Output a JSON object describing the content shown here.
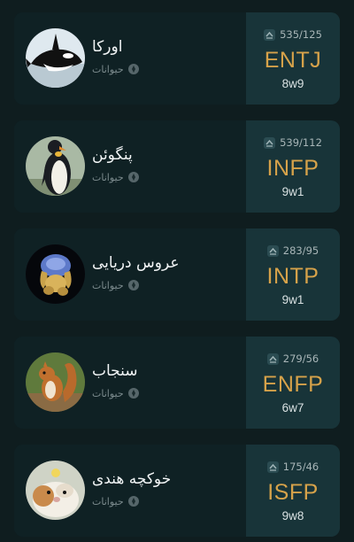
{
  "cards": [
    {
      "name": "اورکا",
      "category": "حیوانات",
      "votes": "535/125",
      "type": "ENTJ",
      "wing": "8w9",
      "avatar_icon": "orca-avatar"
    },
    {
      "name": "پنگوئن",
      "category": "حیوانات",
      "votes": "539/112",
      "type": "INFP",
      "wing": "9w1",
      "avatar_icon": "penguin-avatar"
    },
    {
      "name": "عروس دریایی",
      "category": "حیوانات",
      "votes": "283/95",
      "type": "INTP",
      "wing": "9w1",
      "avatar_icon": "jellyfish-avatar"
    },
    {
      "name": "سنجاب",
      "category": "حیوانات",
      "votes": "279/56",
      "type": "ENFP",
      "wing": "6w7",
      "avatar_icon": "squirrel-avatar"
    },
    {
      "name": "خوکچه هندی",
      "category": "حیوانات",
      "votes": "175/46",
      "type": "ISFP",
      "wing": "9w8",
      "avatar_icon": "guinea-pig-avatar"
    }
  ],
  "colors": {
    "background": "#0f1d1f",
    "card_left": "#0f2124",
    "card_right": "#183439",
    "type_accent": "#d6a24a"
  }
}
